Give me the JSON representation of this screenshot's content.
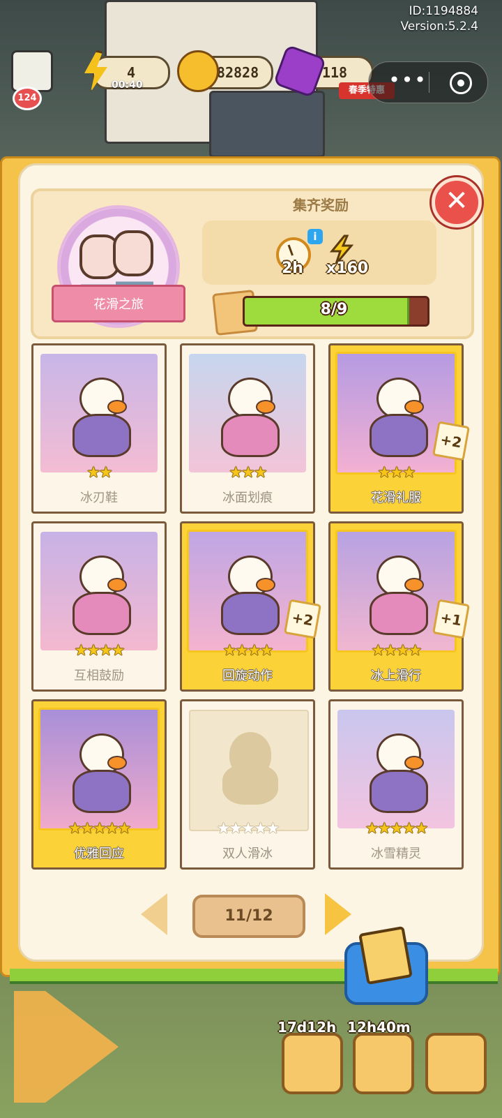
{
  "meta": {
    "id_text": "ID:1194884",
    "version_text": "Version:5.2.4"
  },
  "topbar": {
    "energy_value": "4",
    "energy_timer": "00:40",
    "coins": "182828",
    "gems": "118",
    "level": "124",
    "event_tag": "春季特惠"
  },
  "capsule": {
    "more_glyph": "•••"
  },
  "album": {
    "set_name": "花滑之旅",
    "reward_title": "集齐奖励",
    "reward_time": "2h",
    "reward_energy": "x160",
    "progress_text": "8/9",
    "progress_fraction": 0.889,
    "close_glyph": "✕",
    "info_glyph": "i"
  },
  "cards": [
    {
      "name": "冰刃鞋",
      "stars": "★★",
      "tier": "normal",
      "badge": ""
    },
    {
      "name": "冰面划痕",
      "stars": "★★★",
      "tier": "normal",
      "badge": ""
    },
    {
      "name": "花滑礼服",
      "stars": "★★★",
      "tier": "gold",
      "badge": "+2"
    },
    {
      "name": "互相鼓励",
      "stars": "★★★★",
      "tier": "normal",
      "badge": ""
    },
    {
      "name": "回旋动作",
      "stars": "★★★★",
      "tier": "gold",
      "badge": "+2"
    },
    {
      "name": "冰上滑行",
      "stars": "★★★★",
      "tier": "gold",
      "badge": "+1"
    },
    {
      "name": "优雅回应",
      "stars": "★★★★★",
      "tier": "gold",
      "badge": ""
    },
    {
      "name": "双人滑冰",
      "stars": "★★★★★",
      "tier": "locked",
      "badge": ""
    },
    {
      "name": "冰雪精灵",
      "stars": "★★★★★",
      "tier": "normal",
      "badge": ""
    }
  ],
  "pager": {
    "text": "11/12"
  },
  "bottom": {
    "timer_1": "17d12h",
    "timer_2": "12h40m"
  }
}
